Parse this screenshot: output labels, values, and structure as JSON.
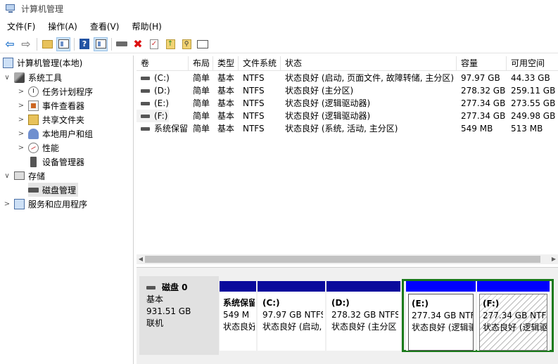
{
  "window": {
    "title": "计算机管理"
  },
  "menu": [
    "文件(F)",
    "操作(A)",
    "查看(V)",
    "帮助(H)"
  ],
  "tree": [
    {
      "label": "计算机管理(本地)",
      "icon": "computer-icon",
      "expander": ""
    },
    {
      "label": "系统工具",
      "icon": "tools-icon",
      "expander": "∨"
    },
    {
      "label": "任务计划程序",
      "icon": "clock-icon",
      "expander": ">"
    },
    {
      "label": "事件查看器",
      "icon": "event-viewer-icon",
      "expander": ">"
    },
    {
      "label": "共享文件夹",
      "icon": "shared-folder-icon",
      "expander": ">"
    },
    {
      "label": "本地用户和组",
      "icon": "users-icon",
      "expander": ">"
    },
    {
      "label": "性能",
      "icon": "performance-icon",
      "expander": ">"
    },
    {
      "label": "设备管理器",
      "icon": "device-manager-icon",
      "expander": ""
    },
    {
      "label": "存储",
      "icon": "storage-icon",
      "expander": "∨"
    },
    {
      "label": "磁盘管理",
      "icon": "disk-icon",
      "expander": ""
    },
    {
      "label": "服务和应用程序",
      "icon": "services-icon",
      "expander": ">"
    }
  ],
  "volumes": {
    "columns": [
      "卷",
      "布局",
      "类型",
      "文件系统",
      "状态",
      "容量",
      "可用空间"
    ],
    "rows": [
      [
        "(C:)",
        "简单",
        "基本",
        "NTFS",
        "状态良好 (启动, 页面文件, 故障转储, 主分区)",
        "97.97 GB",
        "44.33 GB"
      ],
      [
        "(D:)",
        "简单",
        "基本",
        "NTFS",
        "状态良好 (主分区)",
        "278.32 GB",
        "259.11 GB"
      ],
      [
        "(E:)",
        "简单",
        "基本",
        "NTFS",
        "状态良好 (逻辑驱动器)",
        "277.34 GB",
        "273.55 GB"
      ],
      [
        "(F:)",
        "简单",
        "基本",
        "NTFS",
        "状态良好 (逻辑驱动器)",
        "277.34 GB",
        "249.98 GB"
      ],
      [
        "系统保留",
        "简单",
        "基本",
        "NTFS",
        "状态良好 (系统, 活动, 主分区)",
        "549 MB",
        "513 MB"
      ]
    ]
  },
  "disk": {
    "name": "磁盘 0",
    "type": "基本",
    "size": "931.51 GB",
    "status": "联机",
    "partitions": [
      {
        "label": "系统保留",
        "size": "549 M",
        "status": "状态良好"
      },
      {
        "label": "(C:)",
        "size": "97.97 GB NTFS",
        "status": "状态良好 (启动,"
      },
      {
        "label": "(D:)",
        "size": "278.32 GB NTFS",
        "status": "状态良好 (主分区"
      },
      {
        "label": "(E:)",
        "size": "277.34 GB NTF",
        "status": "状态良好 (逻辑驱"
      },
      {
        "label": "(F:)",
        "size": "277.34 GB NTFS",
        "status": "状态良好 (逻辑驱"
      }
    ]
  },
  "colors": {
    "primary_bar": "#0a0a9c",
    "logical_bar": "#0000ff",
    "extended_frame": "#1a7a1a"
  }
}
